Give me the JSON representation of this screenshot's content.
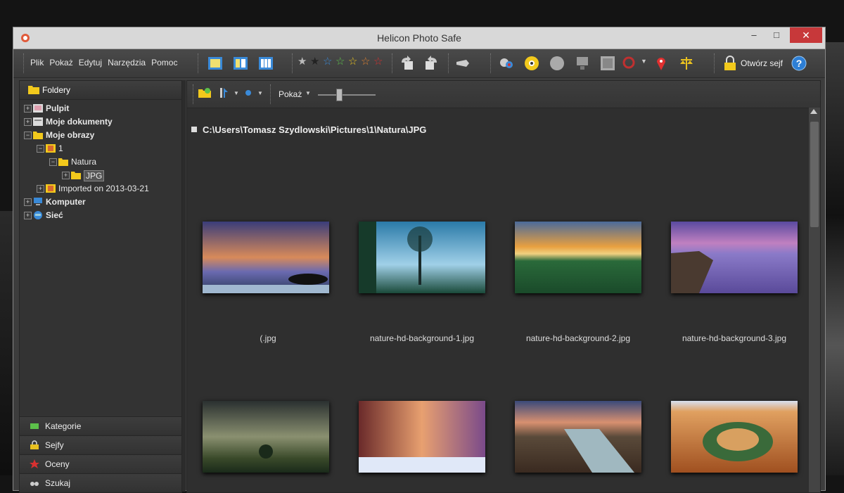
{
  "window": {
    "title": "Helicon Photo Safe"
  },
  "menu": [
    "Plik",
    "Pokaż",
    "Edytuj",
    "Narzędzia",
    "Pomoc"
  ],
  "toolbar": {
    "open_safe_label": "Otwórz sejf"
  },
  "sidebar": {
    "header": "Foldery",
    "tree": [
      {
        "label": "Pulpit"
      },
      {
        "label": "Moje dokumenty"
      },
      {
        "label": "Moje obrazy"
      },
      {
        "label": "1"
      },
      {
        "label": "Natura"
      },
      {
        "label": "JPG"
      },
      {
        "label": "Imported on 2013-03-21"
      },
      {
        "label": "Komputer"
      },
      {
        "label": "Sieć"
      }
    ],
    "bottom_tabs": [
      {
        "label": "Kategorie",
        "color": "#5cc04a"
      },
      {
        "label": "Sejfy",
        "color": "#e8c020"
      },
      {
        "label": "Oceny",
        "color": "#d83030"
      },
      {
        "label": "Szukaj",
        "color": "#cccccc"
      }
    ]
  },
  "content": {
    "toolbar_view_label": "Pokaż",
    "path": "C:\\Users\\Tomasz Szydlowski\\Pictures\\1\\Natura\\JPG",
    "thumbnails": [
      {
        "caption": "(.jpg"
      },
      {
        "caption": "nature-hd-background-1.jpg"
      },
      {
        "caption": "nature-hd-background-2.jpg"
      },
      {
        "caption": "nature-hd-background-3.jpg"
      },
      {
        "caption": ""
      },
      {
        "caption": ""
      },
      {
        "caption": ""
      },
      {
        "caption": ""
      }
    ]
  }
}
